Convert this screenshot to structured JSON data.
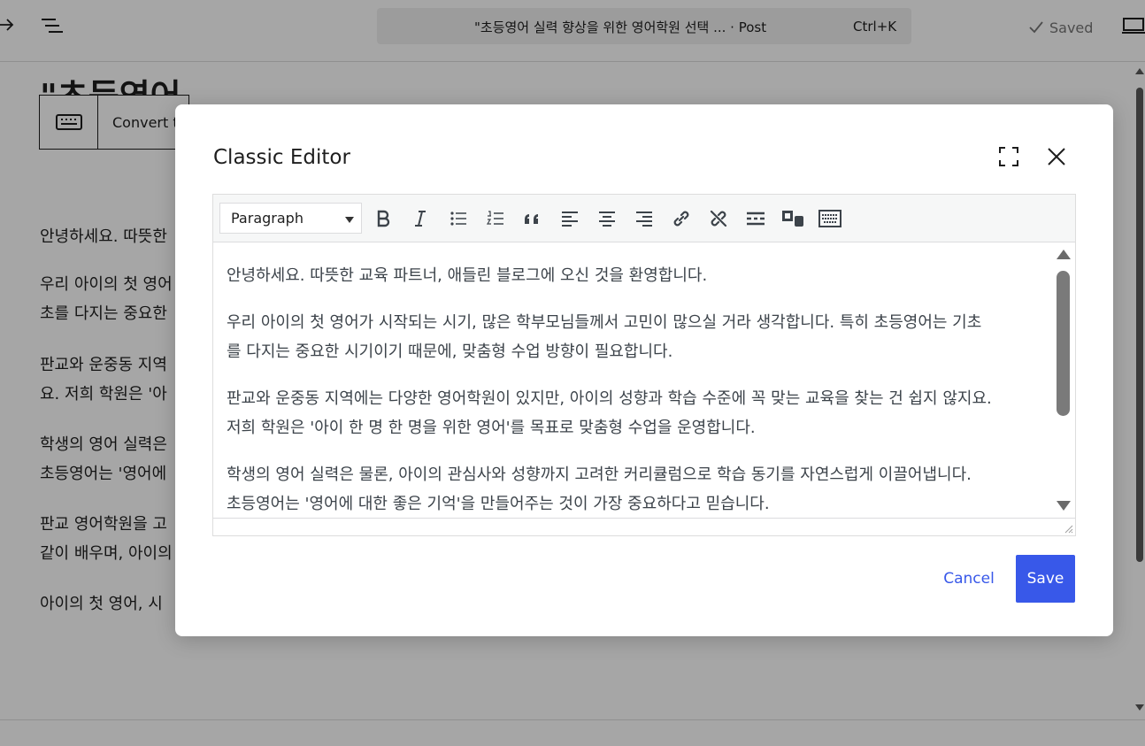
{
  "header": {
    "command_title": "\"초등영어 실력 향상을 위한 영어학원 선택 ... · Post",
    "command_shortcut": "Ctrl+K",
    "saved_label": "Saved"
  },
  "background": {
    "post_title": "\"초등영어",
    "block_convert_label": "Convert to",
    "paragraphs": [
      "안녕하세요. 따뜻한",
      "우리 아이의 첫 영어",
      "초를 다지는 중요한",
      "판교와 운중동 지역",
      "요. 저희 학원은 '아",
      "학생의 영어 실력은",
      "초등영어는 '영어에",
      "판교 영어학원을 고",
      "같이 배우며, 아이의",
      "아이의 첫 영어, 시"
    ]
  },
  "modal": {
    "title": "Classic Editor",
    "format_select": "Paragraph",
    "content_paragraphs": [
      "안녕하세요. 따뜻한 교육 파트너, 애들린 블로그에 오신 것을 환영합니다.",
      "우리 아이의 첫 영어가 시작되는 시기, 많은 학부모님들께서 고민이 많으실 거라 생각합니다. 특히 초등영어는 기초\n를 다지는 중요한 시기이기 때문에, 맞춤형 수업 방향이 필요합니다.",
      "판교와 운중동 지역에는 다양한 영어학원이 있지만, 아이의 성향과 학습 수준에 꼭 맞는 교육을 찾는 건 쉽지 않지요.\n저희 학원은 '아이 한 명 한 명을 위한 영어'를 목표로 맞춤형 수업을 운영합니다.",
      "학생의 영어 실력은 물론, 아이의 관심사와 성향까지 고려한 커리큘럼으로 학습 동기를 자연스럽게 이끌어냅니다.\n초등영어는 '영어에 대한 좋은 기억'을 만들어주는 것이 가장 중요하다고 믿습니다."
    ],
    "cancel_label": "Cancel",
    "save_label": "Save"
  },
  "colors": {
    "accent": "#3858e9",
    "text": "#3c434a"
  }
}
